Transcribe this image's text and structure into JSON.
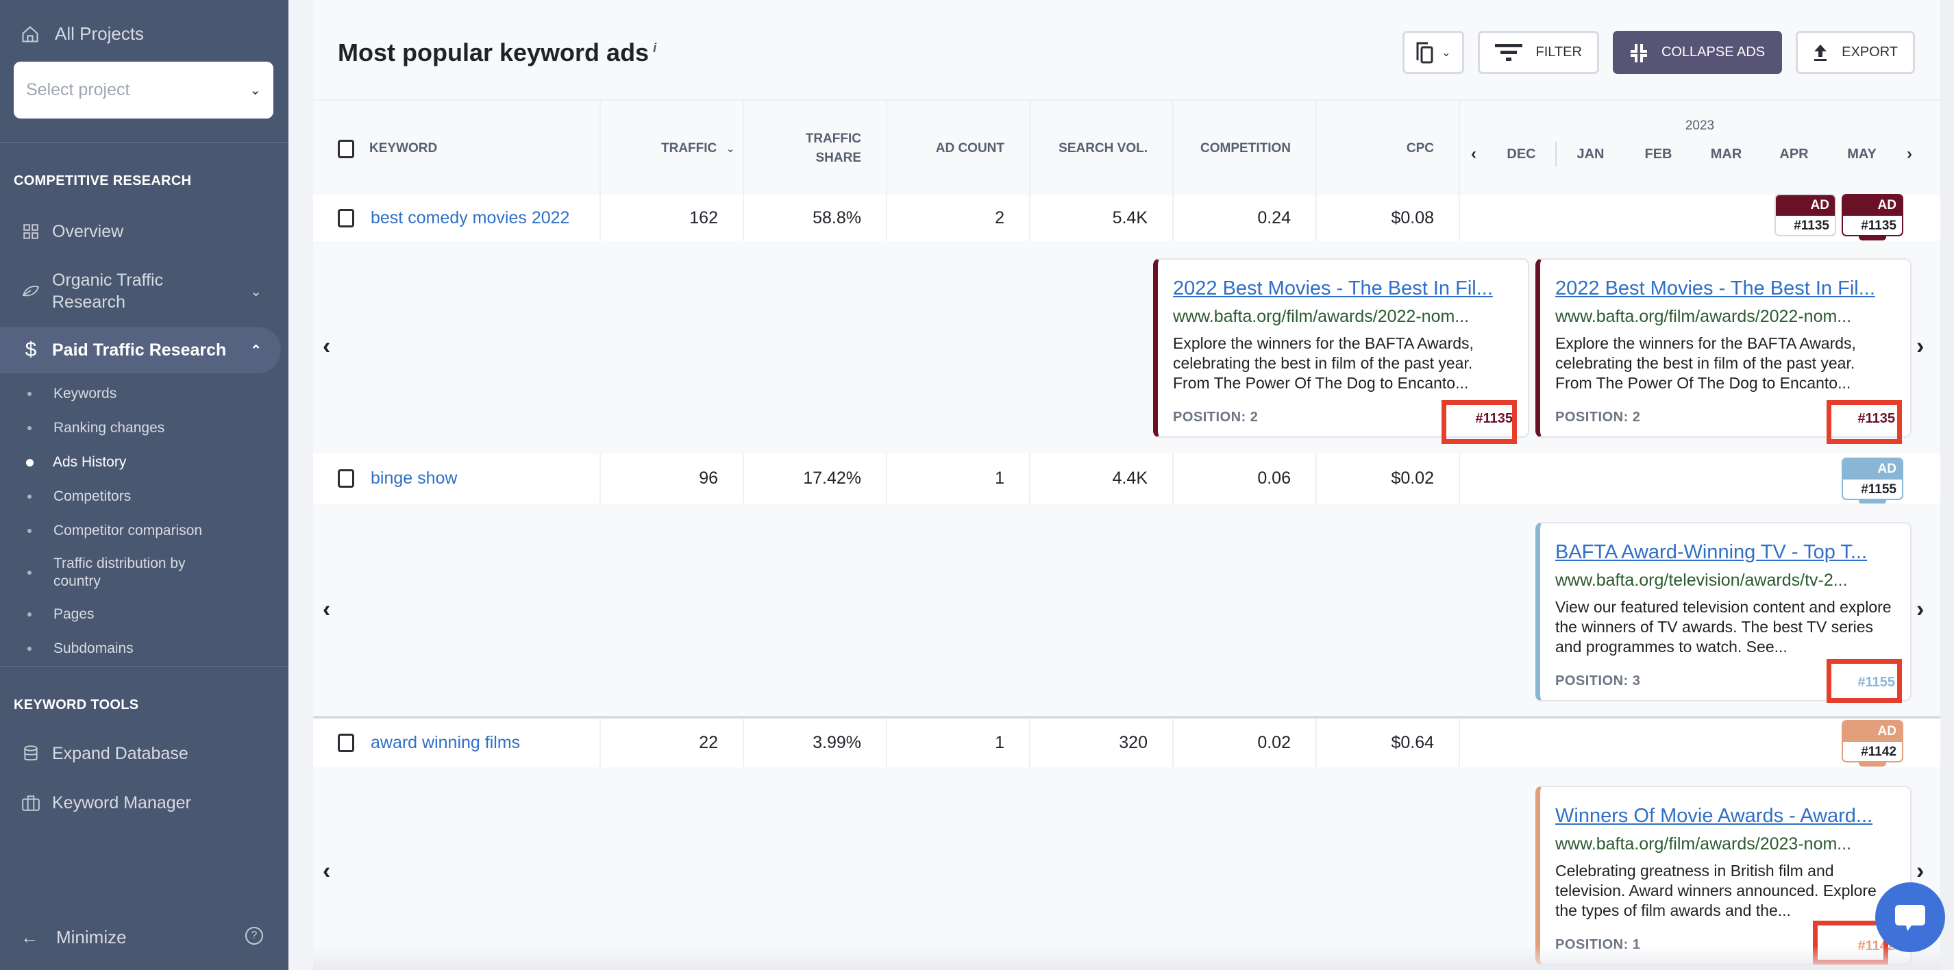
{
  "sidebar": {
    "all_projects": "All Projects",
    "select_project_placeholder": "Select project",
    "section_competitive": "COMPETITIVE RESEARCH",
    "overview": "Overview",
    "organic": "Organic Traffic Research",
    "paid": "Paid Traffic Research",
    "paid_sub": [
      "Keywords",
      "Ranking changes",
      "Ads History",
      "Competitors",
      "Competitor comparison",
      "Traffic distribution by country",
      "Pages",
      "Subdomains"
    ],
    "active_sub": "Ads History",
    "section_keyword_tools": "KEYWORD TOOLS",
    "expand_db": "Expand Database",
    "keyword_manager": "Keyword Manager",
    "minimize": "Minimize"
  },
  "header": {
    "title": "Most popular keyword ads",
    "info": "i",
    "filter": "FILTER",
    "collapse_ads": "COLLAPSE ADS",
    "export": "EXPORT"
  },
  "table": {
    "columns": {
      "keyword": "KEYWORD",
      "traffic": "TRAFFIC",
      "traffic_share": "TRAFFIC SHARE",
      "ad_count": "AD COUNT",
      "search_vol": "SEARCH VOL.",
      "competition": "COMPETITION",
      "cpc": "CPC"
    },
    "year": "2023",
    "months": [
      "DEC",
      "JAN",
      "FEB",
      "MAR",
      "APR",
      "MAY"
    ],
    "rows": [
      {
        "keyword": "best comedy movies 2022",
        "traffic": "162",
        "traffic_share": "58.8%",
        "ad_count": "2",
        "search_vol": "5.4K",
        "competition": "0.24",
        "cpc": "$0.08",
        "badges": [
          {
            "label": "AD",
            "id": "#1135",
            "month": "APR"
          },
          {
            "label": "AD",
            "id": "#1135",
            "month": "MAY"
          }
        ],
        "ads": [
          {
            "title": "2022 Best Movies - The Best In Fil...",
            "url": "www.bafta.org/film/awards/2022-nom...",
            "desc": "Explore the winners for the BAFTA Awards, celebrating the best in film of the past year. From The Power Of The Dog to Encanto...",
            "position": "POSITION: 2",
            "id": "#1135"
          },
          {
            "title": "2022 Best Movies - The Best In Fil...",
            "url": "www.bafta.org/film/awards/2022-nom...",
            "desc": "Explore the winners for the BAFTA Awards, celebrating the best in film of the past year. From The Power Of The Dog to Encanto...",
            "position": "POSITION: 2",
            "id": "#1135"
          }
        ],
        "color": "#6a1126"
      },
      {
        "keyword": "binge show",
        "traffic": "96",
        "traffic_share": "17.42%",
        "ad_count": "1",
        "search_vol": "4.4K",
        "competition": "0.06",
        "cpc": "$0.02",
        "badges": [
          {
            "label": "AD",
            "id": "#1155",
            "month": "MAY"
          }
        ],
        "ads": [
          {
            "title": "BAFTA Award-Winning TV - Top T...",
            "url": "www.bafta.org/television/awards/tv-2...",
            "desc": "View our featured television content and explore the winners of TV awards. The best TV series and programmes to watch. See...",
            "position": "POSITION: 3",
            "id": "#1155"
          }
        ],
        "color": "#8ab6d6"
      },
      {
        "keyword": "award winning films",
        "traffic": "22",
        "traffic_share": "3.99%",
        "ad_count": "1",
        "search_vol": "320",
        "competition": "0.02",
        "cpc": "$0.64",
        "badges": [
          {
            "label": "AD",
            "id": "#1142",
            "month": "MAY"
          }
        ],
        "ads": [
          {
            "title": "Winners Of Movie Awards - Award...",
            "url": "www.bafta.org/film/awards/2023-nom...",
            "desc": "Celebrating greatness in British film and television. Award winners announced. Explore the types of film awards and the...",
            "position": "POSITION: 1",
            "id": "#1142"
          }
        ],
        "color": "#e39e7c"
      }
    ]
  },
  "colors": {
    "sidebar_bg": "#4a5770",
    "primary_button": "#585475",
    "link": "#2f6fc6",
    "highlight_box": "#e53e2a",
    "chat_button": "#3f72d8"
  }
}
